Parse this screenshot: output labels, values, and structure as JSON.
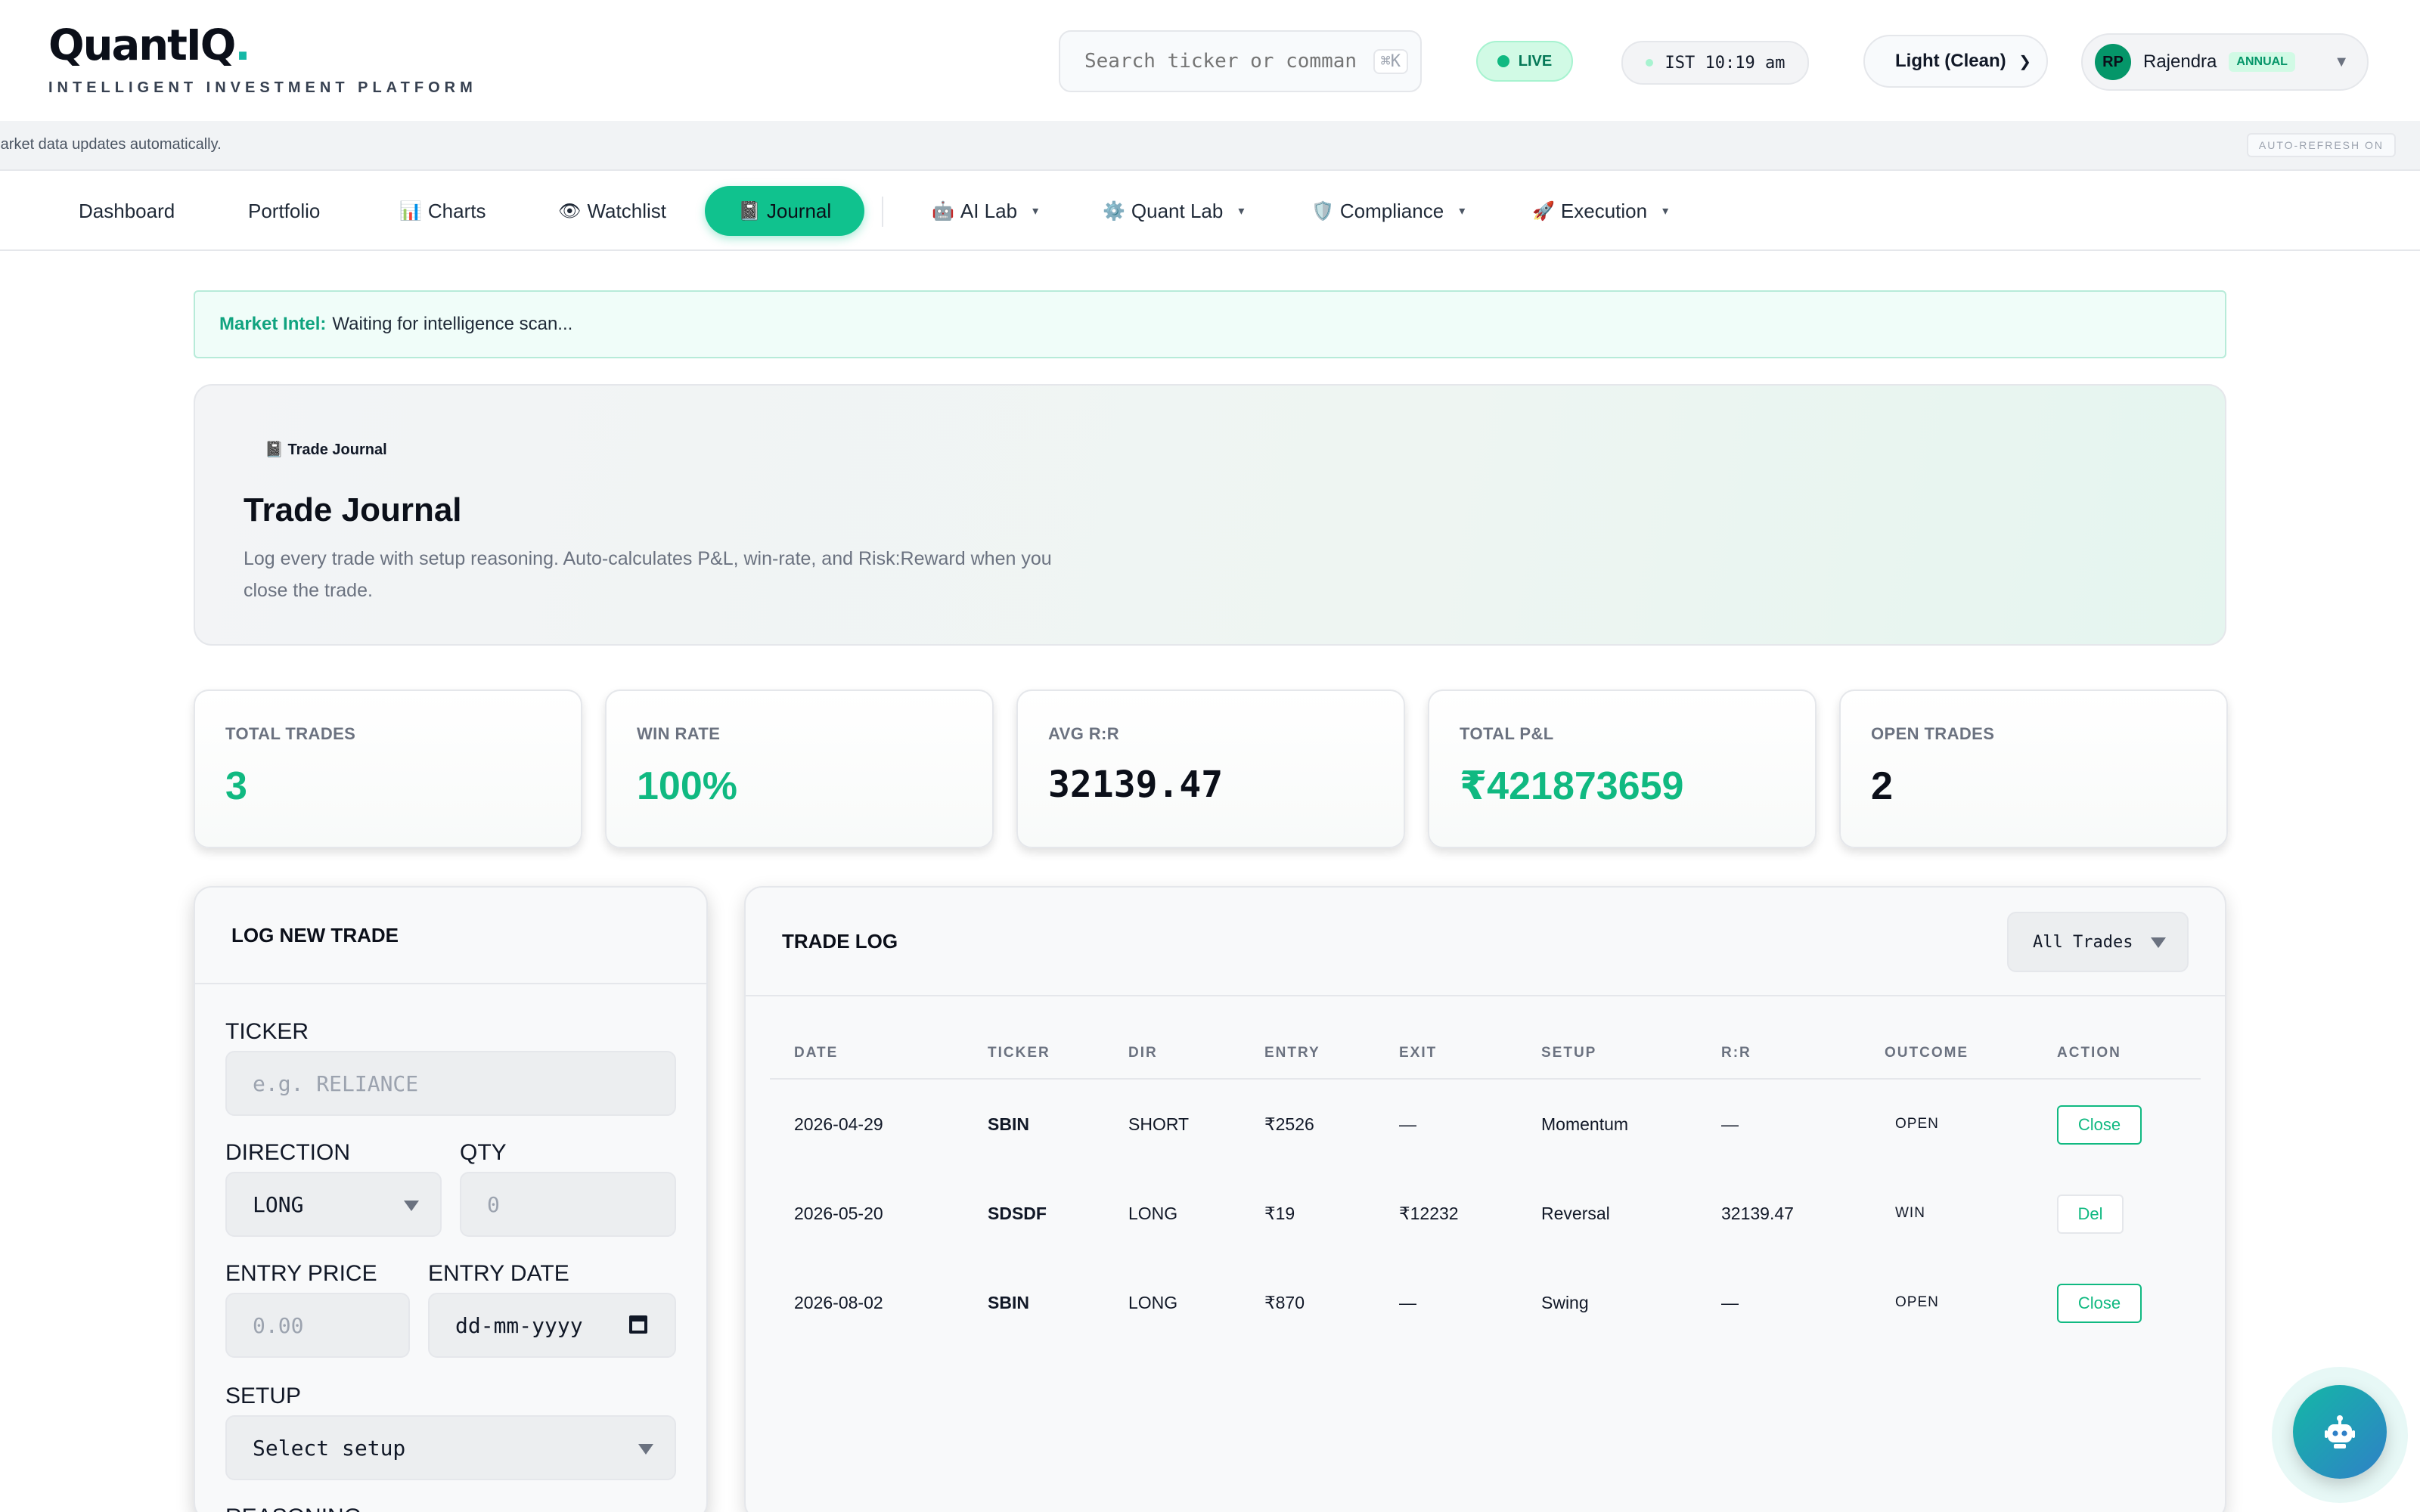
{
  "header": {
    "logo_text": "QuantIQ",
    "logo_dot": ".",
    "logo_tagline": "INTELLIGENT INVESTMENT PLATFORM",
    "search_placeholder": "Search ticker or command...",
    "search_shortcut": "⌘K",
    "live_label": "LIVE",
    "clock": "IST 10:19 am",
    "theme_selected": "Light (Clean)",
    "user_initials": "RP",
    "user_name": "Rajendra",
    "user_plan": "ANNUAL"
  },
  "infobar": {
    "text": "Market data updates automatically.",
    "auto_refresh": "AUTO-REFRESH ON"
  },
  "nav": {
    "items": [
      {
        "label": "Dashboard",
        "icon": ""
      },
      {
        "label": "Portfolio",
        "icon": ""
      },
      {
        "label": "Charts",
        "icon": "📊"
      },
      {
        "label": "Watchlist",
        "icon": "👁"
      },
      {
        "label": "Journal",
        "icon": "📓"
      },
      {
        "label": "AI Lab",
        "icon": "🤖"
      },
      {
        "label": "Quant Lab",
        "icon": "⚙️"
      },
      {
        "label": "Compliance",
        "icon": "🛡️"
      },
      {
        "label": "Execution",
        "icon": "🚀"
      }
    ],
    "active": "Journal"
  },
  "intel": {
    "label": "Market Intel:",
    "text": "Waiting for intelligence scan..."
  },
  "hero": {
    "tag_icon": "📓",
    "tag": "Trade Journal",
    "title": "Trade Journal",
    "description": "Log every trade with setup reasoning. Auto-calculates P&L, win-rate, and Risk:Reward when you close the trade."
  },
  "stats": [
    {
      "label": "TOTAL TRADES",
      "value": "3"
    },
    {
      "label": "WIN RATE",
      "value": "100%"
    },
    {
      "label": "AVG R:R",
      "value": "32139.47"
    },
    {
      "label": "TOTAL P&L",
      "value": "₹421873659"
    },
    {
      "label": "OPEN TRADES",
      "value": "2"
    }
  ],
  "form": {
    "title": "LOG NEW TRADE",
    "ticker_label": "TICKER",
    "ticker_placeholder": "e.g. RELIANCE",
    "direction_label": "DIRECTION",
    "direction_value": "LONG",
    "qty_label": "QTY",
    "qty_placeholder": "0",
    "entry_price_label": "ENTRY PRICE",
    "entry_price_placeholder": "0.00",
    "entry_date_label": "ENTRY DATE",
    "entry_date_placeholder": "dd-mm-yyyy",
    "setup_label": "SETUP",
    "setup_value": "Select setup",
    "reasoning_label": "REASONING"
  },
  "tradelog": {
    "title": "TRADE LOG",
    "filter": "All Trades",
    "columns": [
      "DATE",
      "TICKER",
      "DIR",
      "ENTRY",
      "EXIT",
      "SETUP",
      "R:R",
      "OUTCOME",
      "ACTION"
    ],
    "rows": [
      {
        "date": "2026-04-29",
        "ticker": "SBIN",
        "dir": "SHORT",
        "entry": "₹2526",
        "exit": "—",
        "setup": "Momentum",
        "rr": "—",
        "outcome": "OPEN",
        "action": "Close"
      },
      {
        "date": "2026-05-20",
        "ticker": "SDSDF",
        "dir": "LONG",
        "entry": "₹19",
        "exit": "₹12232",
        "setup": "Reversal",
        "rr": "32139.47",
        "outcome": "WIN",
        "action": "Del"
      },
      {
        "date": "2026-08-02",
        "ticker": "SBIN",
        "dir": "LONG",
        "entry": "₹870",
        "exit": "—",
        "setup": "Swing",
        "rr": "—",
        "outcome": "OPEN",
        "action": "Close"
      }
    ]
  },
  "assistant": {
    "icon": "robot-icon"
  }
}
